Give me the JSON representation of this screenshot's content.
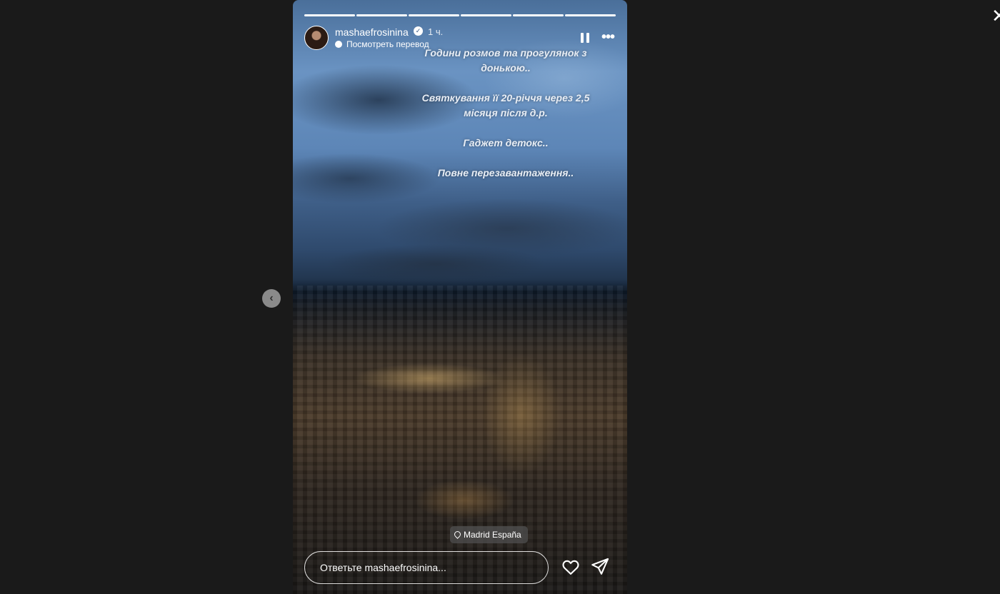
{
  "story": {
    "username": "mashaefrosinina",
    "time": "1 ч.",
    "translate_label": "Посмотреть перевод",
    "progress_segments": 6,
    "lines": [
      "Години розмов та прогулянок з донькою..",
      "Святкування її 20-річчя через 2,5 місяця після д.р.",
      "Гаджет детокс..",
      "Повне перезавантаження.."
    ],
    "location": "Madrid España",
    "reply_placeholder": "Ответьте mashaefrosinina..."
  },
  "icons": {
    "close": "close-icon",
    "prev": "chevron-left-icon",
    "verified": "verified-badge-icon",
    "translate": "speech-bubble-icon",
    "pause": "pause-icon",
    "more": "more-horizontal-icon",
    "location": "location-pin-icon",
    "like": "heart-icon",
    "send": "send-icon"
  }
}
